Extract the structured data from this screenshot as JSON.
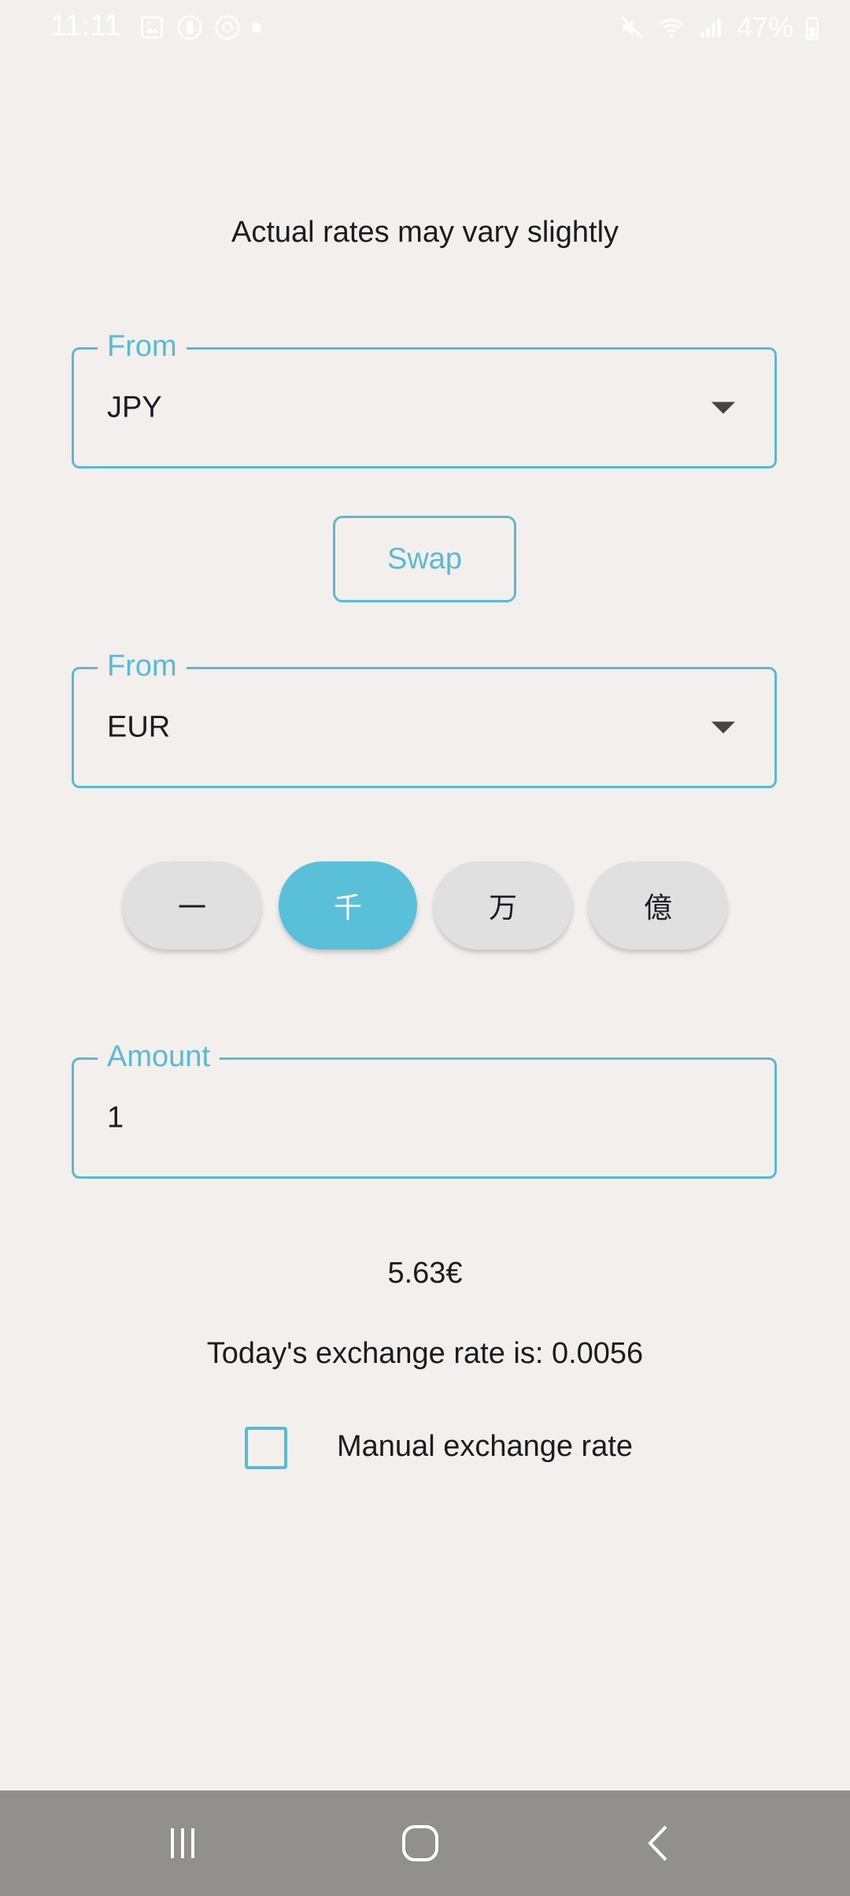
{
  "status_bar": {
    "time": "11:11",
    "battery": "47%"
  },
  "headline": "Actual rates may vary slightly",
  "from_field": {
    "label": "From",
    "value": "JPY"
  },
  "swap_label": "Swap",
  "to_field": {
    "label": "From",
    "value": "EUR"
  },
  "units": [
    {
      "label": "一",
      "selected": false
    },
    {
      "label": "千",
      "selected": true
    },
    {
      "label": "万",
      "selected": false
    },
    {
      "label": "億",
      "selected": false
    }
  ],
  "amount_field": {
    "label": "Amount",
    "value": "1"
  },
  "result": "5.63€",
  "rate_text": "Today's exchange rate is: 0.0056",
  "manual_rate": {
    "label": "Manual exchange rate",
    "checked": false
  },
  "colors": {
    "accent": "#5ab9d3",
    "background": "#f2efed",
    "nav_bar": "#92908e",
    "chip": "#e1e0e0"
  }
}
